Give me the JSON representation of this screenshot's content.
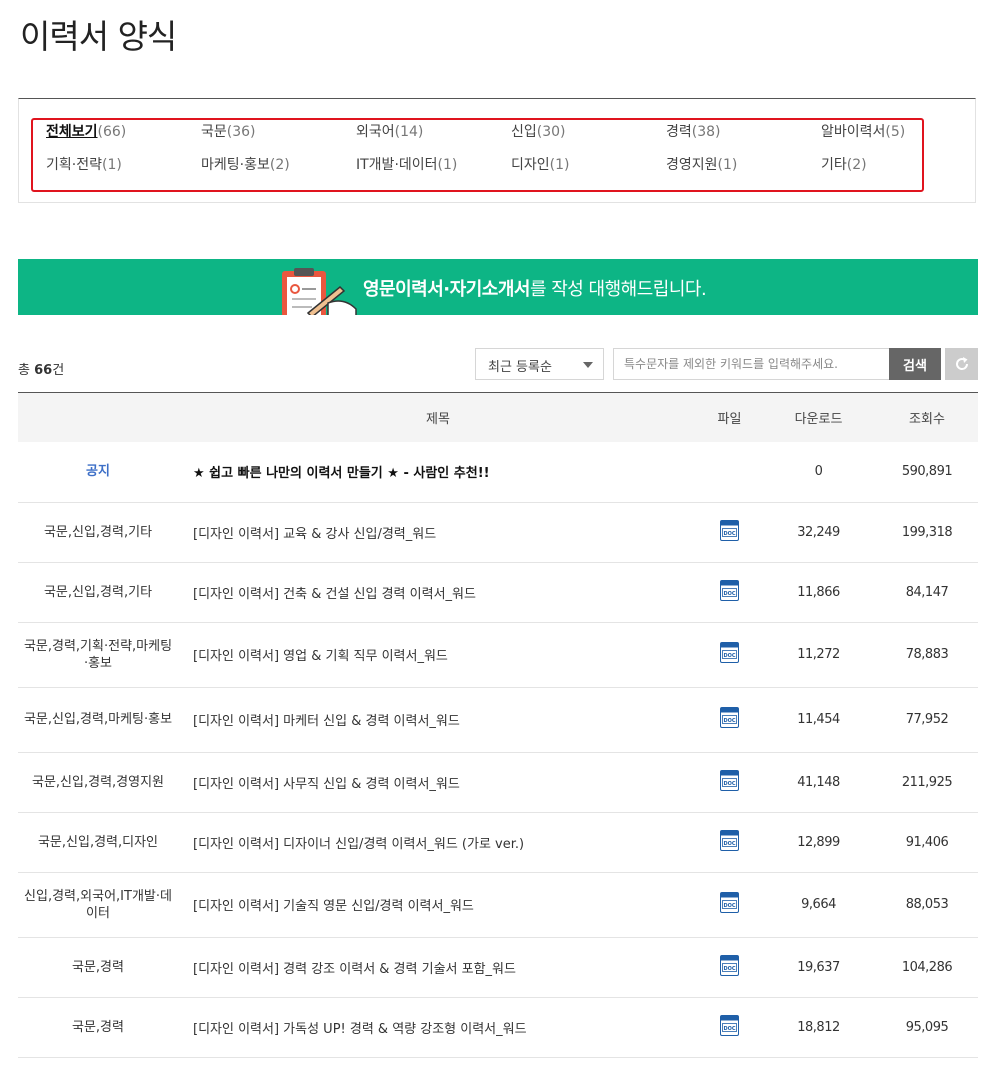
{
  "page_title": "이력서 양식",
  "categories": [
    {
      "name": "전체보기",
      "count": "(66)",
      "active": true
    },
    {
      "name": "국문",
      "count": "(36)"
    },
    {
      "name": "외국어",
      "count": "(14)"
    },
    {
      "name": "신입",
      "count": "(30)"
    },
    {
      "name": "경력",
      "count": "(38)"
    },
    {
      "name": "알바이력서",
      "count": "(5)"
    },
    {
      "name": "기획·전략",
      "count": "(1)"
    },
    {
      "name": "마케팅·홍보",
      "count": "(2)"
    },
    {
      "name": "IT개발·데이터",
      "count": "(1)"
    },
    {
      "name": "디자인",
      "count": "(1)"
    },
    {
      "name": "경영지원",
      "count": "(1)"
    },
    {
      "name": "기타",
      "count": "(2)"
    }
  ],
  "banner": {
    "bold": "영문이력서·자기소개서",
    "rest": "를 작성 대행해드립니다.",
    "color": "#0db585"
  },
  "toolbar": {
    "total_prefix": "총 ",
    "total_count": "66",
    "total_suffix": "건",
    "sort_selected": "최근 등록순",
    "search_placeholder": "특수문자를 제외한 키워드를 입력해주세요.",
    "search_label": "검색",
    "reset_icon": "refresh-icon"
  },
  "table": {
    "headers": {
      "title": "제목",
      "file": "파일",
      "downloads": "다운로드",
      "views": "조회수"
    },
    "rows": [
      {
        "category": "공지",
        "title": "★ 쉽고 빠른 나만의 이력서 만들기 ★ - 사람인 추천!!",
        "file": "",
        "downloads": "0",
        "views": "590,891",
        "notice": true
      },
      {
        "category": "국문,신입,경력,기타",
        "title": "[디자인 이력서] 교육 & 강사 신입/경력_워드",
        "file": "doc-icon",
        "downloads": "32,249",
        "views": "199,318"
      },
      {
        "category": "국문,신입,경력,기타",
        "title": "[디자인 이력서] 건축 & 건설 신입 경력 이력서_워드",
        "file": "doc-icon",
        "downloads": "11,866",
        "views": "84,147"
      },
      {
        "category": "국문,경력,기획·전략,마케팅·홍보",
        "title": "[디자인 이력서] 영업 & 기획 직무 이력서_워드",
        "file": "doc-icon",
        "downloads": "11,272",
        "views": "78,883"
      },
      {
        "category": "국문,신입,경력,마케팅·홍보",
        "title": "[디자인 이력서] 마케터 신입 & 경력 이력서_워드",
        "file": "doc-icon",
        "downloads": "11,454",
        "views": "77,952"
      },
      {
        "category": "국문,신입,경력,경영지원",
        "title": "[디자인 이력서] 사무직 신입 & 경력 이력서_워드",
        "file": "doc-icon",
        "downloads": "41,148",
        "views": "211,925"
      },
      {
        "category": "국문,신입,경력,디자인",
        "title": "[디자인 이력서] 디자이너 신입/경력 이력서_워드 (가로 ver.)",
        "file": "doc-icon",
        "downloads": "12,899",
        "views": "91,406"
      },
      {
        "category": "신입,경력,외국어,IT개발·데이터",
        "title": "[디자인 이력서] 기술직 영문 신입/경력 이력서_워드",
        "file": "doc-icon",
        "downloads": "9,664",
        "views": "88,053"
      },
      {
        "category": "국문,경력",
        "title": "[디자인 이력서] 경력 강조 이력서 & 경력 기술서 포함_워드",
        "file": "doc-icon",
        "downloads": "19,637",
        "views": "104,286"
      },
      {
        "category": "국문,경력",
        "title": "[디자인 이력서] 가독성 UP! 경력 & 역량 강조형 이력서_워드",
        "file": "doc-icon",
        "downloads": "18,812",
        "views": "95,095"
      }
    ]
  }
}
